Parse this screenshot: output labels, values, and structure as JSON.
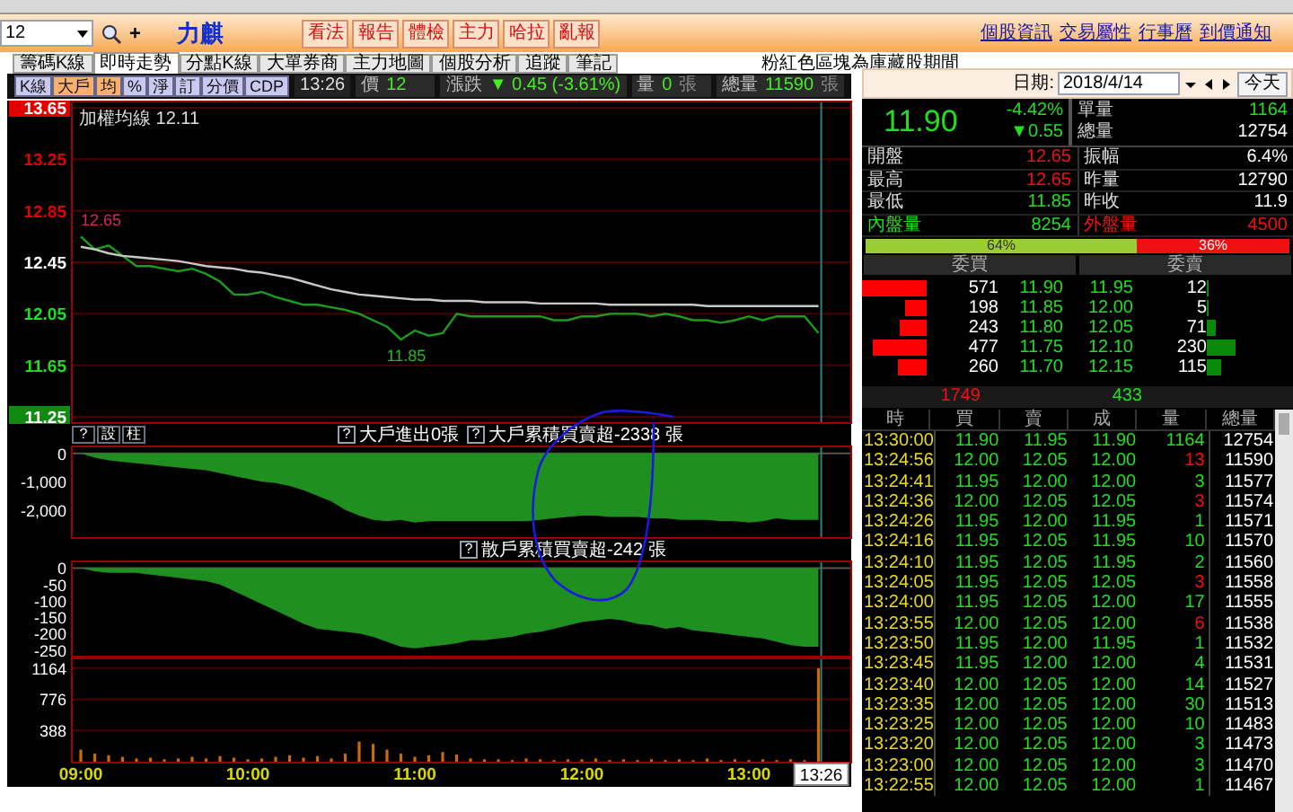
{
  "toolbar": {
    "stock_code": "12",
    "add": "+",
    "stock_name": "力麒",
    "buttons": [
      "看法",
      "報告",
      "體檢",
      "主力",
      "哈拉",
      "亂報"
    ],
    "links": [
      "個股資訊",
      "交易屬性",
      "行事曆",
      "到價通知"
    ]
  },
  "tabs": [
    {
      "label": "籌碼K線",
      "selected": false
    },
    {
      "label": "即時走勢",
      "selected": true
    },
    {
      "label": "分點K線",
      "selected": false
    },
    {
      "label": "大單券商",
      "selected": false
    },
    {
      "label": "主力地圖",
      "selected": false
    },
    {
      "label": "個股分析",
      "selected": false
    },
    {
      "label": "追蹤",
      "selected": false
    },
    {
      "label": "筆記",
      "selected": false
    }
  ],
  "notice": "粉紅色區塊為庫藏股期間",
  "chart_header": {
    "buttons": [
      {
        "label": "K線",
        "selected": false
      },
      {
        "label": "大戶",
        "selected": true
      },
      {
        "label": "均",
        "selected": true
      },
      {
        "label": "%",
        "selected": false
      },
      {
        "label": "淨",
        "selected": false
      },
      {
        "label": "訂",
        "selected": false
      },
      {
        "label": "分價",
        "selected": false
      },
      {
        "label": "CDP",
        "selected": false
      }
    ],
    "time": "13:26",
    "fields": [
      {
        "label": "價",
        "value": "12"
      },
      {
        "label": "漲跌",
        "value": "▼ 0.45 (-3.61%)"
      },
      {
        "label": "量",
        "value": "0",
        "unit": "張"
      },
      {
        "label": "總量",
        "value": "11590",
        "unit": "張"
      }
    ]
  },
  "price_chart": {
    "legend": "加權均線 12.11",
    "chart_data": {
      "type": "line",
      "series": [
        {
          "color": "#1c9c1c",
          "values": [
            12.65,
            12.55,
            12.58,
            12.5,
            12.42,
            12.42,
            12.4,
            12.38,
            12.4,
            12.36,
            12.3,
            12.2,
            12.2,
            12.22,
            12.18,
            12.15,
            12.12,
            12.12,
            12.1,
            12.08,
            12.05,
            12.0,
            11.95,
            11.85,
            11.92,
            11.88,
            11.9,
            12.05,
            12.03,
            12.03,
            12.03,
            12.03,
            12.03,
            12.03,
            12.0,
            12.0,
            12.03,
            12.03,
            12.05,
            12.05,
            12.05,
            12.03,
            12.05,
            12.03,
            12.0,
            12.0,
            11.98,
            12.0,
            12.03,
            12.0,
            12.03,
            12.03,
            12.03,
            11.9
          ]
        },
        {
          "color": "#c8c8c8",
          "values": [
            12.57,
            12.55,
            12.52,
            12.5,
            12.49,
            12.48,
            12.47,
            12.46,
            12.44,
            12.42,
            12.41,
            12.4,
            12.38,
            12.37,
            12.35,
            12.33,
            12.3,
            12.27,
            12.24,
            12.22,
            12.2,
            12.19,
            12.18,
            12.17,
            12.16,
            12.16,
            12.15,
            12.15,
            12.15,
            12.14,
            12.14,
            12.14,
            12.14,
            12.13,
            12.13,
            12.13,
            12.13,
            12.13,
            12.12,
            12.12,
            12.12,
            12.12,
            12.12,
            12.12,
            12.12,
            12.11,
            12.11,
            12.11,
            12.11,
            12.11,
            12.11,
            12.11,
            12.11,
            12.11
          ]
        }
      ],
      "ylim": [
        11.25,
        13.65
      ],
      "grid": true,
      "yticks": [
        {
          "value": 13.65,
          "label": "13.65"
        },
        {
          "value": 13.25,
          "label": "13.25"
        },
        {
          "value": 12.85,
          "label": "12.85"
        },
        {
          "value": 12.45,
          "label": "12.45"
        },
        {
          "value": 12.05,
          "label": "12.05"
        },
        {
          "value": 11.65,
          "label": "11.65"
        },
        {
          "value": 11.25,
          "label": "11.25"
        }
      ],
      "annotations": [
        "12.65",
        "11.85"
      ]
    }
  },
  "chart_tools": [
    "?",
    "設",
    "柱"
  ],
  "big_flow": {
    "help": "?",
    "text": "大戶進出0張"
  },
  "big_cumulative": {
    "help": "?",
    "text": "大戶累積買賣超-2338 張",
    "chart_data": {
      "type": "area",
      "series": [
        {
          "color": "#1f8f1f",
          "values": [
            0,
            -150,
            -250,
            -300,
            -350,
            -400,
            -450,
            -500,
            -550,
            -600,
            -700,
            -800,
            -900,
            -1000,
            -1050,
            -1150,
            -1300,
            -1500,
            -1700,
            -2000,
            -2200,
            -2350,
            -2400,
            -2350,
            -2450,
            -2400,
            -2400,
            -2400,
            -2400,
            -2400,
            -2400,
            -2400,
            -2400,
            -2350,
            -2300,
            -2250,
            -2200,
            -2200,
            -2250,
            -2250,
            -2250,
            -2300,
            -2300,
            -2350,
            -2350,
            -2350,
            -2400,
            -2400,
            -2450,
            -2400,
            -2300,
            -2350,
            -2350,
            -2350
          ]
        }
      ],
      "ylim": [
        -2900,
        150
      ],
      "yticks": [
        {
          "value": 0,
          "label": "0"
        },
        {
          "value": -1000,
          "label": "-1,000"
        },
        {
          "value": -2000,
          "label": "-2,000"
        }
      ]
    }
  },
  "retail_cumulative": {
    "help": "?",
    "text": "散戶累積買賣超-242 張",
    "chart_data": {
      "type": "area",
      "series": [
        {
          "color": "#1f8f1f",
          "values": [
            0,
            -10,
            -15,
            -15,
            -15,
            -20,
            -25,
            -30,
            -35,
            -40,
            -50,
            -70,
            -90,
            -110,
            -130,
            -150,
            -170,
            -185,
            -190,
            -195,
            -200,
            -210,
            -225,
            -240,
            -245,
            -240,
            -235,
            -230,
            -220,
            -220,
            -215,
            -210,
            -200,
            -195,
            -185,
            -175,
            -165,
            -160,
            -155,
            -160,
            -170,
            -175,
            -185,
            -180,
            -190,
            -195,
            -200,
            -205,
            -210,
            -215,
            -225,
            -235,
            -240,
            -240
          ]
        }
      ],
      "ylim": [
        -262,
        12
      ],
      "yticks": [
        0,
        -50,
        -100,
        -150,
        -200,
        -250
      ]
    }
  },
  "volume_chart": {
    "cursor_time": "13:26",
    "chart_data": {
      "type": "bar",
      "categories": [
        "09:00",
        null,
        null,
        null,
        null,
        null,
        null,
        null,
        null,
        null,
        null,
        null,
        "10:00",
        null,
        null,
        null,
        null,
        null,
        null,
        null,
        null,
        null,
        null,
        null,
        "11:00",
        null,
        null,
        null,
        null,
        null,
        null,
        null,
        null,
        null,
        null,
        null,
        "12:00",
        null,
        null,
        null,
        null,
        null,
        null,
        null,
        null,
        null,
        null,
        null,
        "13:00",
        null,
        null,
        null,
        null,
        null
      ],
      "series": [
        {
          "color": "#c86a10",
          "values": [
            150,
            100,
            80,
            60,
            40,
            50,
            30,
            40,
            60,
            40,
            70,
            50,
            30,
            40,
            60,
            80,
            50,
            70,
            40,
            100,
            250,
            220,
            150,
            100,
            60,
            80,
            120,
            90,
            40,
            30,
            30,
            20,
            40,
            30,
            20,
            30,
            30,
            40,
            20,
            30,
            20,
            30,
            20,
            30,
            20,
            40,
            20,
            30,
            20,
            30,
            20,
            30,
            20,
            1160
          ]
        }
      ],
      "ylim": [
        0,
        1250
      ],
      "grid": true,
      "yticks": [
        388,
        776,
        1164
      ]
    }
  },
  "date_bar": {
    "label": "日期:",
    "value": "2018/4/14",
    "today": "今天"
  },
  "quote": {
    "price": "11.90",
    "change_pct": "-4.42%",
    "change": "▼0.55",
    "volume": [
      {
        "label": "單量",
        "value": "1164",
        "kind": "down"
      },
      {
        "label": "總量",
        "value": "12754",
        "kind": "flat"
      }
    ],
    "rows": [
      [
        {
          "label": "開盤",
          "value": "12.65",
          "kind": "up"
        },
        {
          "label": "振幅",
          "value": "6.4%",
          "kind": "flat"
        }
      ],
      [
        {
          "label": "最高",
          "value": "12.65",
          "kind": "up"
        },
        {
          "label": "昨量",
          "value": "12790",
          "kind": "flat"
        }
      ],
      [
        {
          "label": "最低",
          "value": "11.85",
          "kind": "down"
        },
        {
          "label": "昨收",
          "value": "11.9",
          "kind": "flat"
        }
      ],
      [
        {
          "label": "內盤量",
          "value": "8254",
          "kind": "inner"
        },
        {
          "label": "外盤量",
          "value": "4500",
          "kind": "outer"
        }
      ]
    ],
    "ratio": {
      "buy": "64%",
      "sell": "36%",
      "level": 0.64
    }
  },
  "order_book": {
    "headers": [
      "委買",
      "委賣"
    ],
    "rows": [
      {
        "bid": {
          "qty": "571",
          "price": "11.90"
        },
        "ask": {
          "price": "11.95",
          "qty": "12"
        }
      },
      {
        "bid": {
          "qty": "198",
          "price": "11.85"
        },
        "ask": {
          "price": "12.00",
          "qty": "5"
        }
      },
      {
        "bid": {
          "qty": "243",
          "price": "11.80"
        },
        "ask": {
          "price": "12.05",
          "qty": "71"
        }
      },
      {
        "bid": {
          "qty": "477",
          "price": "11.75"
        },
        "ask": {
          "price": "12.10",
          "qty": "230"
        }
      },
      {
        "bid": {
          "qty": "260",
          "price": "11.70"
        },
        "ask": {
          "price": "12.15",
          "qty": "115"
        }
      }
    ],
    "bid_total": "1749",
    "ask_total": "433"
  },
  "ticks": {
    "columns": [
      "時",
      "買",
      "賣",
      "成",
      "量",
      "總量"
    ],
    "rows": [
      {
        "time": "13:30:00",
        "bid": "11.90",
        "ask": "11.95",
        "price": "11.90",
        "qty": "1164",
        "total": "12754",
        "kind": "inner"
      },
      {
        "time": "13:24:56",
        "bid": "12.00",
        "ask": "12.05",
        "price": "12.00",
        "qty": "13",
        "total": "11590",
        "kind": "outer"
      },
      {
        "time": "13:24:41",
        "bid": "11.95",
        "ask": "12.00",
        "price": "12.00",
        "qty": "3",
        "total": "11577",
        "kind": "inner"
      },
      {
        "time": "13:24:36",
        "bid": "12.00",
        "ask": "12.05",
        "price": "12.05",
        "qty": "3",
        "total": "11574",
        "kind": "outer"
      },
      {
        "time": "13:24:26",
        "bid": "11.95",
        "ask": "12.00",
        "price": "11.95",
        "qty": "1",
        "total": "11571",
        "kind": "inner"
      },
      {
        "time": "13:24:16",
        "bid": "11.95",
        "ask": "12.05",
        "price": "11.95",
        "qty": "10",
        "total": "11570",
        "kind": "inner"
      },
      {
        "time": "13:24:10",
        "bid": "11.95",
        "ask": "12.05",
        "price": "11.95",
        "qty": "2",
        "total": "11560",
        "kind": "inner"
      },
      {
        "time": "13:24:05",
        "bid": "11.95",
        "ask": "12.05",
        "price": "12.05",
        "qty": "3",
        "total": "11558",
        "kind": "outer"
      },
      {
        "time": "13:24:00",
        "bid": "11.95",
        "ask": "12.05",
        "price": "12.00",
        "qty": "17",
        "total": "11555",
        "kind": "inner"
      },
      {
        "time": "13:23:55",
        "bid": "12.00",
        "ask": "12.05",
        "price": "12.00",
        "qty": "6",
        "total": "11538",
        "kind": "outer"
      },
      {
        "time": "13:23:50",
        "bid": "11.95",
        "ask": "12.00",
        "price": "11.95",
        "qty": "1",
        "total": "11532",
        "kind": "inner"
      },
      {
        "time": "13:23:45",
        "bid": "11.95",
        "ask": "12.00",
        "price": "12.00",
        "qty": "4",
        "total": "11531",
        "kind": "inner"
      },
      {
        "time": "13:23:40",
        "bid": "12.00",
        "ask": "12.05",
        "price": "12.00",
        "qty": "14",
        "total": "11527",
        "kind": "inner"
      },
      {
        "time": "13:23:35",
        "bid": "12.00",
        "ask": "12.05",
        "price": "12.00",
        "qty": "30",
        "total": "11513",
        "kind": "inner"
      },
      {
        "time": "13:23:25",
        "bid": "12.00",
        "ask": "12.05",
        "price": "12.00",
        "qty": "10",
        "total": "11483",
        "kind": "inner"
      },
      {
        "time": "13:23:20",
        "bid": "12.00",
        "ask": "12.05",
        "price": "12.00",
        "qty": "3",
        "total": "11473",
        "kind": "inner"
      },
      {
        "time": "13:23:00",
        "bid": "12.00",
        "ask": "12.05",
        "price": "12.00",
        "qty": "3",
        "total": "11470",
        "kind": "inner"
      },
      {
        "time": "13:22:55",
        "bid": "12.00",
        "ask": "12.05",
        "price": "12.00",
        "qty": "1",
        "total": "11467",
        "kind": "inner"
      }
    ]
  }
}
